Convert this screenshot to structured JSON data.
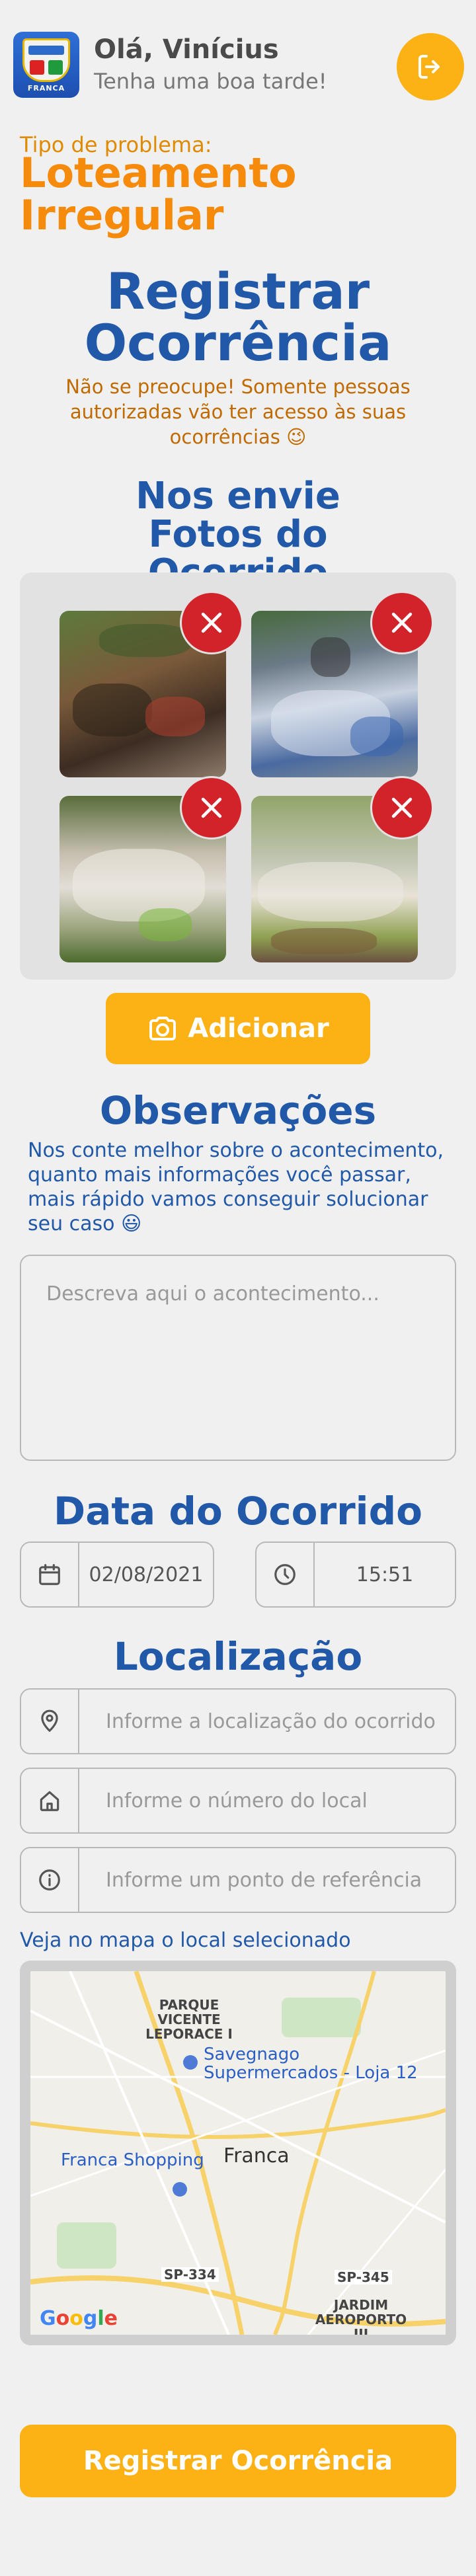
{
  "header": {
    "logo_text": "FRANCA",
    "greeting": "Olá, Vinícius",
    "subtitle": "Tenha uma boa tarde!"
  },
  "problem": {
    "label": "Tipo de problema:",
    "type": "Loteamento Irregular"
  },
  "register": {
    "title": "Registrar Ocorrência",
    "note": "Não se preocupe! Somente pessoas autorizadas vão ter acesso às suas ocorrências 😉"
  },
  "photos": {
    "title": "Nos envie Fotos do Ocorrido",
    "add_label": "Adicionar"
  },
  "observations": {
    "title": "Observações",
    "text": "Nos conte melhor sobre o acontecimento, quanto mais informações você passar, mais rápido vamos conseguir solucionar seu caso 😃",
    "placeholder": "Descreva aqui o acontecimento..."
  },
  "date": {
    "title": "Data do Ocorrido",
    "date_value": "02/08/2021",
    "time_value": "15:51"
  },
  "location": {
    "title": "Localização",
    "location_placeholder": "Informe a localização do ocorrido",
    "number_placeholder": "Informe o número do local",
    "reference_placeholder": "Informe um ponto de referência",
    "map_label": "Veja no mapa o local selecionado"
  },
  "map": {
    "labels": {
      "parque": "PARQUE VICENTE LEPORACE I",
      "savegnago": "Savegnago Supermercados - Loja 12",
      "shopping": "Franca Shopping",
      "city": "Franca",
      "sp334": "SP-334",
      "sp345": "SP-345",
      "jardim": "JARDIM AEROPORTO III",
      "google": "Google"
    },
    "colors": {
      "road": "#f7d26a",
      "green": "#cfe6c4",
      "water": "#aad3df"
    }
  },
  "submit_label": "Registrar Ocorrência",
  "colors": {
    "primary_blue": "#2159a8",
    "orange": "#f58a0b",
    "yellow_button": "#fcb114",
    "delete_red": "#d2232a"
  }
}
